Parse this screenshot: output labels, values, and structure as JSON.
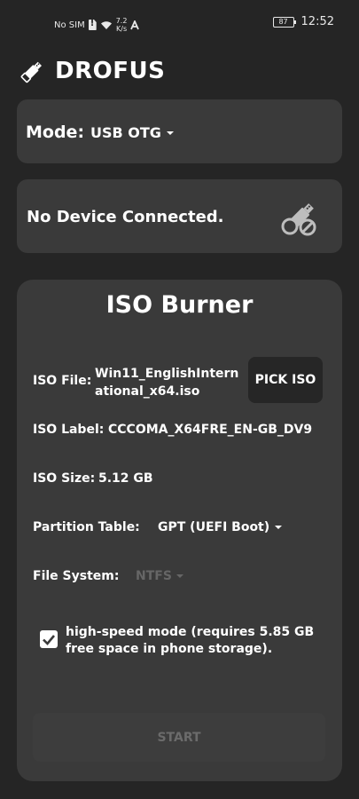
{
  "status_bar": {
    "carrier": "No SIM",
    "speed_value": "7.2",
    "speed_unit": "K/s",
    "battery": "87",
    "time": "12:52",
    "icons": [
      "sim-alert-icon",
      "wifi-icon",
      "data-speed",
      "a-icon",
      "battery-icon"
    ]
  },
  "header": {
    "app_name": "DROFUS",
    "logo_icon": "usb-stick-icon"
  },
  "mode": {
    "label": "Mode:",
    "selected": "USB OTG"
  },
  "device": {
    "status": "No Device Connected.",
    "icon": "usb-disconnected-icon"
  },
  "iso": {
    "title": "ISO Burner",
    "file_label": "ISO File:",
    "file_line1": "Win11_EnglishIntern",
    "file_line2": "ational_x64.iso",
    "pick_button": "PICK ISO",
    "label_label": "ISO Label:",
    "label_value": "CCCOMA_X64FRE_EN-GB_DV9",
    "size_label": "ISO Size:",
    "size_value": "5.12 GB",
    "partition_label": "Partition Table:",
    "partition_value": "GPT (UEFI Boot)",
    "filesystem_label": "File System:",
    "filesystem_value": "NTFS",
    "highspeed_checked": true,
    "highspeed_line1": "high-speed mode (requires 5.85 GB",
    "highspeed_line2": "free space in phone storage).",
    "start_button": "START"
  },
  "colors": {
    "background": "#252525",
    "card": "#3a3a3a",
    "button_dark": "#262626",
    "disabled_text": "#6b6b6b"
  }
}
